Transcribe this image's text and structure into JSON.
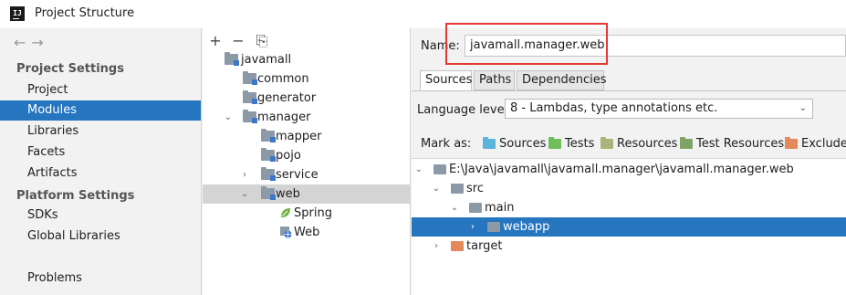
{
  "window": {
    "app_icon_text": "IJ",
    "title": "Project Structure"
  },
  "left_nav": {
    "back_arrow": "←",
    "forward_arrow": "→",
    "sections": [
      {
        "title": "Project Settings",
        "items": [
          "Project",
          "Modules",
          "Libraries",
          "Facets",
          "Artifacts"
        ]
      },
      {
        "title": "Platform Settings",
        "items": [
          "SDKs",
          "Global Libraries"
        ]
      }
    ],
    "bottom_item": "Problems",
    "selected": "Modules"
  },
  "module_tree": {
    "toolbar": {
      "add": "+",
      "remove": "−",
      "copy": "⎘"
    },
    "nodes": [
      {
        "label": "javamall",
        "icon": "module-folder-icon",
        "expand": ""
      },
      {
        "label": "common",
        "icon": "module-folder-icon",
        "expand": ""
      },
      {
        "label": "generator",
        "icon": "module-folder-icon",
        "expand": ""
      },
      {
        "label": "manager",
        "icon": "module-folder-icon",
        "expand": "⌄"
      },
      {
        "label": "mapper",
        "icon": "module-folder-icon",
        "expand": ""
      },
      {
        "label": "pojo",
        "icon": "module-folder-icon",
        "expand": ""
      },
      {
        "label": "service",
        "icon": "module-folder-icon",
        "expand": "›"
      },
      {
        "label": "web",
        "icon": "module-folder-icon",
        "expand": "⌄"
      },
      {
        "label": "Spring",
        "icon": "spring-leaf-icon",
        "expand": ""
      },
      {
        "label": "Web",
        "icon": "web-facet-icon",
        "expand": ""
      }
    ],
    "selected": "web"
  },
  "details": {
    "name_label": "Name:",
    "name_value": "javamall.manager.web",
    "tabs": [
      "Sources",
      "Paths",
      "Dependencies"
    ],
    "active_tab": "Sources",
    "language_level_label": "Language level:",
    "language_level_value": "8 - Lambdas, type annotations etc.",
    "mark_as_label": "Mark as:",
    "mark_as": [
      {
        "label": "Sources",
        "underline": "S",
        "color": "#5ab4dc"
      },
      {
        "label": "Tests",
        "underline": "T",
        "color": "#6cbf5a"
      },
      {
        "label": "Resources",
        "underline": "",
        "color": "#a9b37a"
      },
      {
        "label": "Test Resources",
        "underline": "",
        "color": "#7fa365"
      },
      {
        "label": "Excluded",
        "underline": "",
        "color": "#e4895a"
      }
    ],
    "content_tree": [
      {
        "label": "E:\\Java\\javamall\\javamall.manager\\javamall.manager.web",
        "expand": "⌄",
        "icon": "gray-folder-icon"
      },
      {
        "label": "src",
        "expand": "⌄",
        "icon": "gray-folder-icon"
      },
      {
        "label": "main",
        "expand": "⌄",
        "icon": "gray-folder-icon"
      },
      {
        "label": "webapp",
        "expand": "›",
        "icon": "gray-folder-icon"
      },
      {
        "label": "target",
        "expand": "›",
        "icon": "orange-folder-icon"
      }
    ],
    "content_selected": "webapp"
  },
  "colors": {
    "selection": "#2675bf",
    "highlight_border": "#e53935"
  }
}
